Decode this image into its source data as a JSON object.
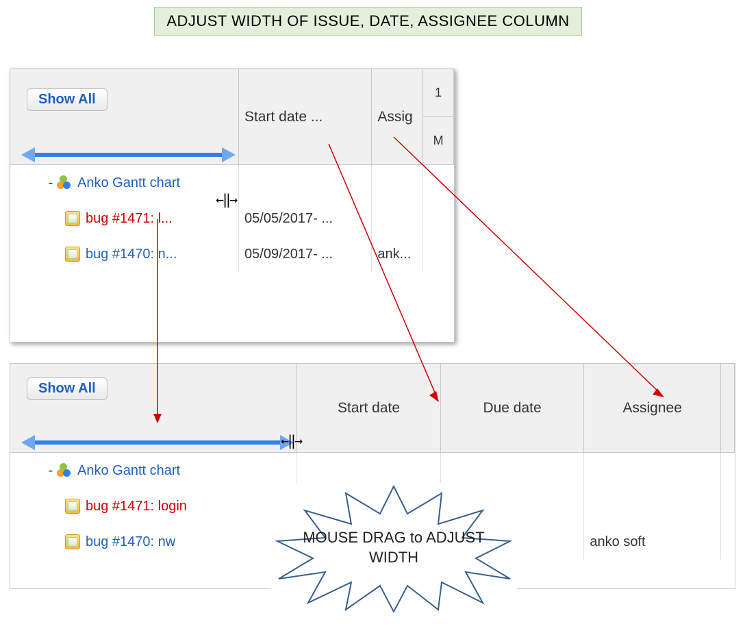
{
  "banner": {
    "text": "ADJUST WIDTH OF ISSUE, DATE, ASSIGNEE COLUMN"
  },
  "callout": {
    "text": "MOUSE DRAG to ADJUST WIDTH"
  },
  "resizeGlyph": "←‖→",
  "panel1": {
    "showAll": "Show All",
    "headers": {
      "start": "Start date ...",
      "assignee": "Assig"
    },
    "cal": {
      "top": "1",
      "bottom": "M"
    },
    "rows": [
      {
        "icon": "project",
        "label": "Anko Gantt chart",
        "labelClass": "link",
        "start": "",
        "assignee": ""
      },
      {
        "icon": "bug",
        "label": "bug #1471: l...",
        "labelClass": "link red",
        "start": "05/05/2017- ...",
        "assignee": ""
      },
      {
        "icon": "bug",
        "label": "bug #1470: n...",
        "labelClass": "link",
        "start": "05/09/2017- ...",
        "assignee": "ank..."
      }
    ],
    "cols": {
      "issue": 335,
      "start": 195,
      "assignee": 75,
      "cal": 45
    }
  },
  "panel2": {
    "showAll": "Show All",
    "headers": {
      "start": "Start date",
      "due": "Due date",
      "assignee": "Assignee"
    },
    "rows": [
      {
        "icon": "project",
        "label": "Anko Gantt chart",
        "labelClass": "link",
        "start": "",
        "due": "",
        "assignee": ""
      },
      {
        "icon": "bug",
        "label": "bug #1471: login",
        "labelClass": "link red",
        "start": "",
        "due": "",
        "assignee": ""
      },
      {
        "icon": "bug",
        "label": "bug #1470: nw",
        "labelClass": "link",
        "start": "",
        "due": "",
        "assignee": "anko soft"
      }
    ],
    "cols": {
      "issue": 420,
      "start": 210,
      "due": 210,
      "assignee": 200,
      "cal": 20
    }
  }
}
